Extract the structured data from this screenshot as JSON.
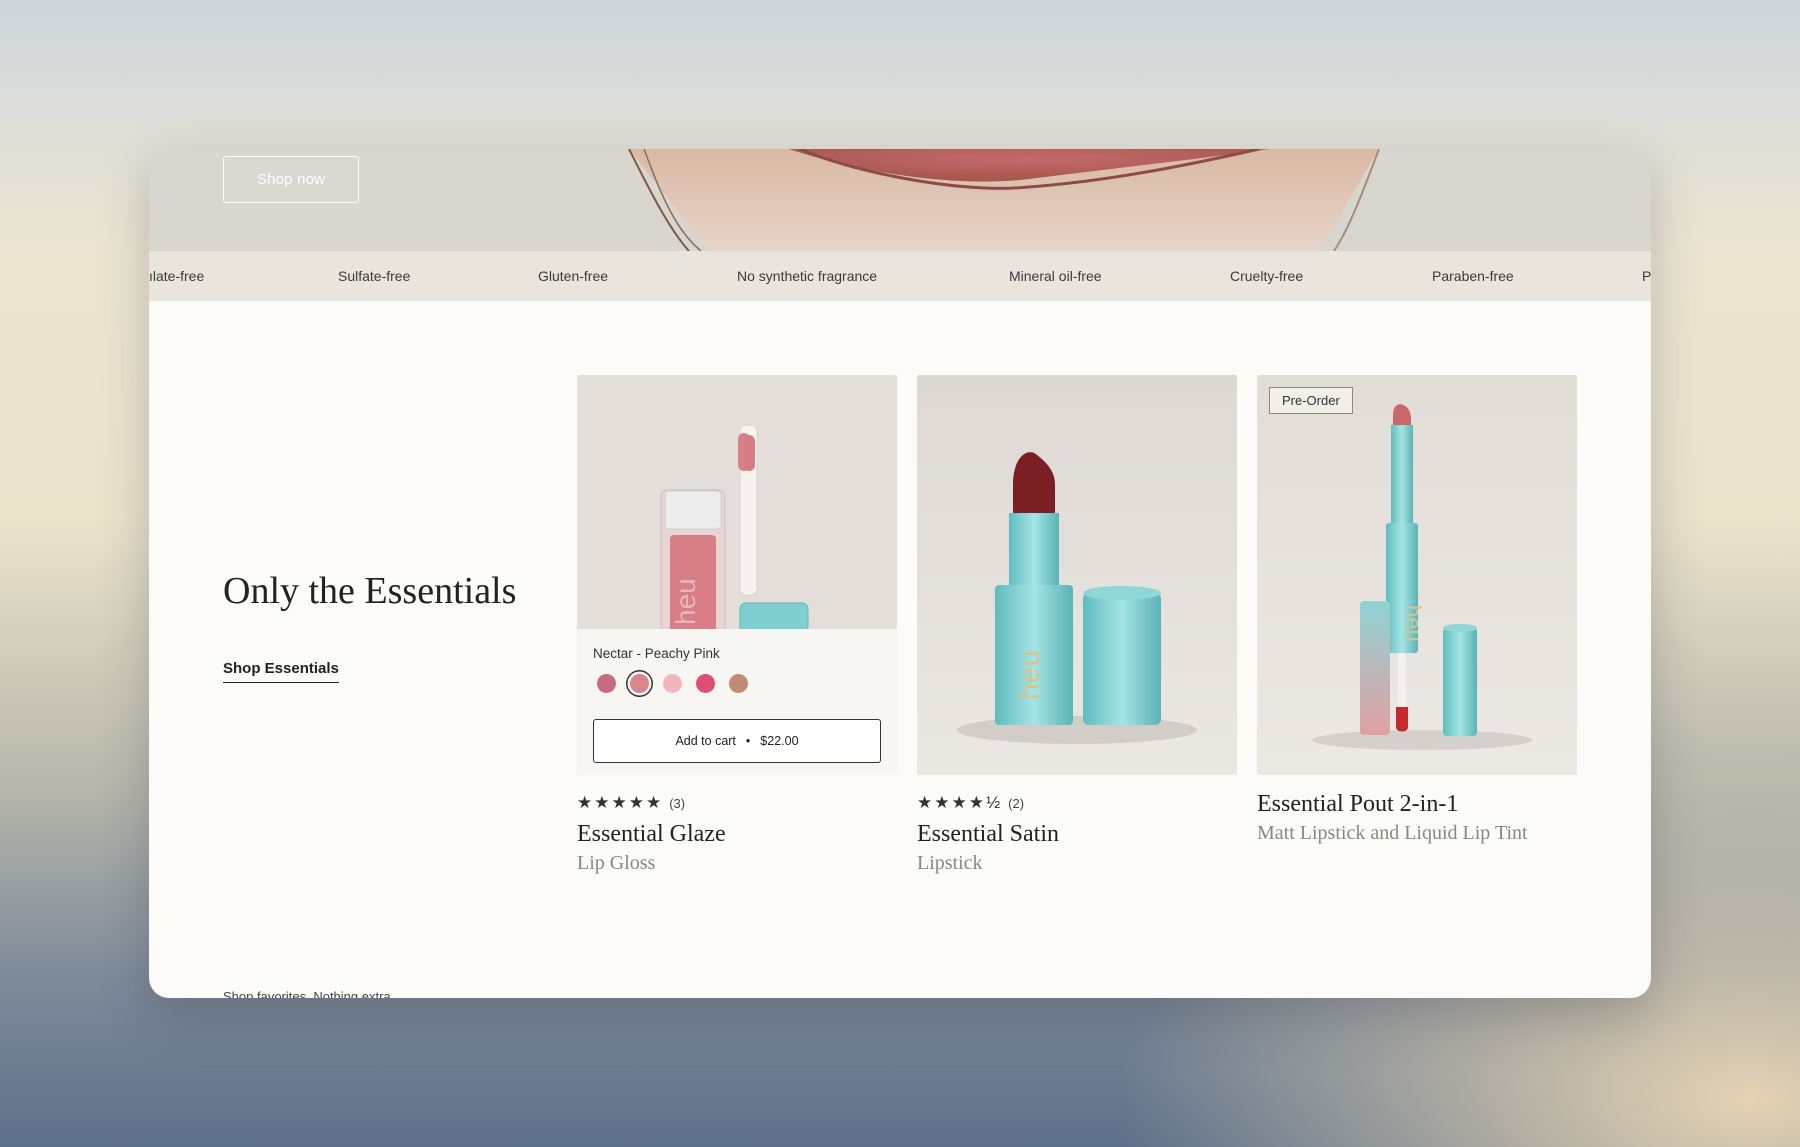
{
  "hero": {
    "cta_label": "Shop now"
  },
  "marquee": {
    "items": [
      "ılate-free",
      "Sulfate-free",
      "Gluten-free",
      "No synthetic fragrance",
      "Mineral oil-free",
      "Cruelty-free",
      "Paraben-free",
      "P"
    ]
  },
  "section": {
    "title": "Only the Essentials",
    "link_label": "Shop Essentials",
    "footer_peek": "Shop favorites. Nothing extra."
  },
  "products": [
    {
      "name": "Essential Glaze",
      "subtitle": "Lip Gloss",
      "stars": "★★★★★",
      "rating_count": "(3)",
      "selected_shade": "Nectar - Peachy Pink",
      "shades": [
        "#c76c7e",
        "#d8868c",
        "#f1b6ba",
        "#dc5075",
        "#c08c72"
      ],
      "add_to_cart": "Add to cart",
      "price": "$22.00"
    },
    {
      "name": "Essential Satin",
      "subtitle": "Lipstick",
      "stars": "★★★★½",
      "rating_count": "(2)"
    },
    {
      "name": "Essential Pout 2-in-1",
      "subtitle": "Matt Lipstick and Liquid Lip Tint",
      "badge": "Pre-Order"
    }
  ],
  "colors": {
    "packaging_teal": "#7fcfd0",
    "page_bg": "#fcfbf8",
    "marquee_bg": "#e9e5dc"
  }
}
